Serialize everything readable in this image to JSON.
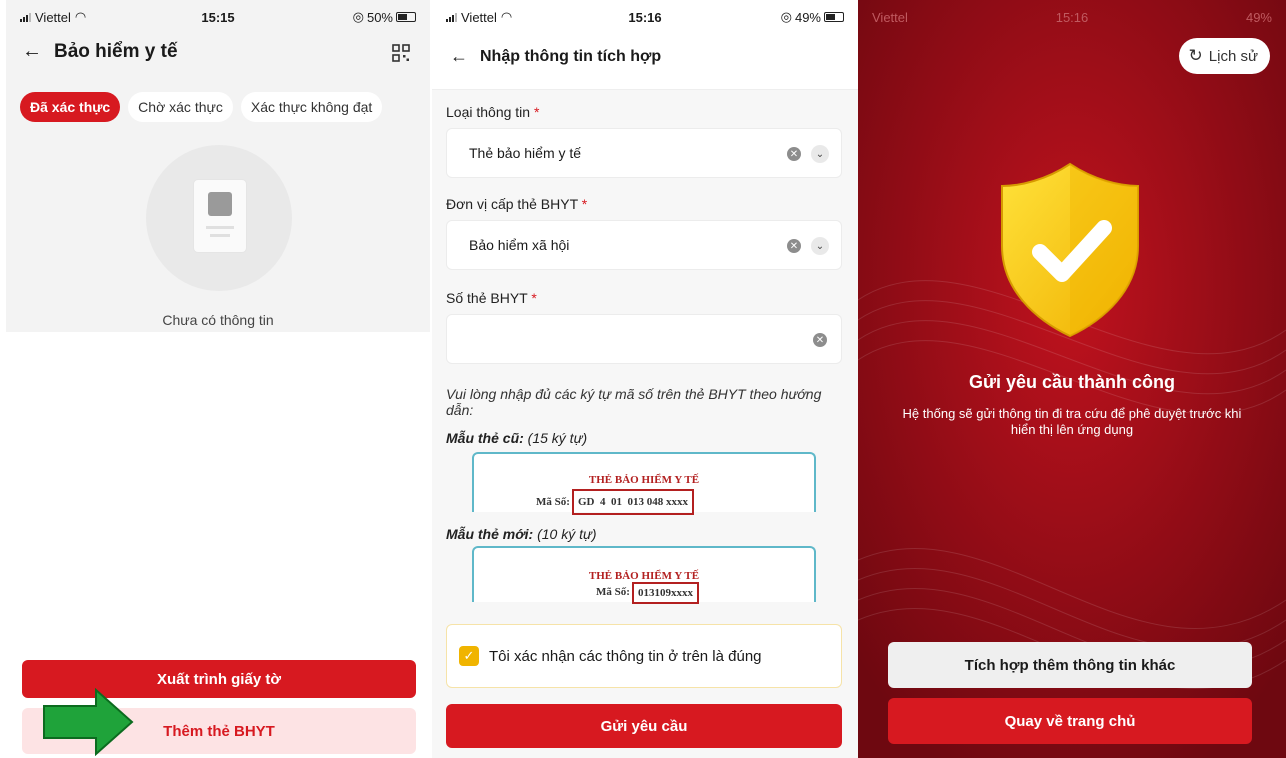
{
  "screen1": {
    "status": {
      "carrier": "Viettel",
      "time": "15:15",
      "battery": "50%"
    },
    "title": "Bảo hiểm y tế",
    "tabs": [
      "Đã xác thực",
      "Chờ xác thực",
      "Xác thực không đạt"
    ],
    "empty_text": "Chưa có thông tin",
    "btn_present": "Xuất trình giấy tờ",
    "btn_add": "Thêm thẻ BHYT",
    "icons": [
      "back-arrow-icon",
      "qr-scan-icon",
      "green-arrow-icon"
    ]
  },
  "screen2": {
    "status": {
      "carrier": "Viettel",
      "time": "15:16",
      "battery": "49%"
    },
    "title": "Nhập thông tin tích hợp",
    "info_type_label": "Loại thông tin",
    "info_type_value": "Thẻ bảo hiểm y tế",
    "issuer_label": "Đơn vị cấp thẻ BHYT",
    "issuer_value": "Bảo hiểm xã hội",
    "card_no_label": "Số thẻ BHYT",
    "required_mark": "*",
    "hint": "Vui lòng nhập đủ các ký tự mã số trên thẻ BHYT theo hướng dẫn:",
    "old_sample_label": "Mẫu thẻ cũ:",
    "old_sample_note": "(15 ký tự)",
    "new_sample_label": "Mẫu thẻ mới:",
    "new_sample_note": "(10 ký tự)",
    "card_title": "THẺ BẢO HIỂM Y TẾ",
    "card_code_label": "Mã Số:",
    "old_code": "GD  4  01  013 048 xxxx",
    "new_code": "013109xxxx",
    "confirm_text": "Tôi xác nhận các thông tin ở trên là đúng",
    "confirm_checked": true,
    "submit": "Gửi yêu cầu"
  },
  "screen3": {
    "status": {
      "carrier": "Viettel",
      "time": "15:16",
      "battery": "49%"
    },
    "history": "Lịch sử",
    "success_title": "Gửi yêu cầu thành công",
    "success_desc_1": "Hệ thống sẽ gửi thông tin đi tra cứu để phê duyệt trước khi",
    "success_desc_2": "hiển thị lên ứng dụng",
    "btn_more": "Tích hợp thêm thông tin khác",
    "btn_home": "Quay về trang chủ"
  },
  "colors": {
    "brand_red": "#d71920",
    "dark_red_bg": "#8e0b14",
    "shield_yellow": "#f5c400",
    "arrow_green": "#1fa33a"
  }
}
